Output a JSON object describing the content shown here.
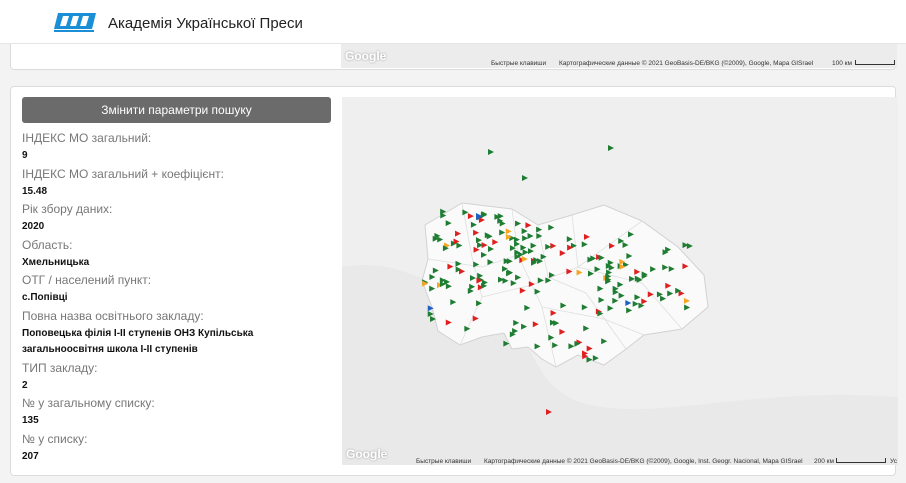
{
  "header": {
    "brand": "Академія Української Преси",
    "logo_icon": "aup-logo-icon"
  },
  "top_map": {
    "google": "Google",
    "shortcuts": "Быстрые клавиши",
    "attribution": "Картографические данные © 2021 GeoBasis-DE/BKG (©2009), Google, Mapa GISrael",
    "scale": "100 км"
  },
  "search": {
    "button_label": "Змінити параметри пошуку"
  },
  "fields": [
    {
      "label": "ІНДЕКС МО загальний:",
      "value": "9"
    },
    {
      "label": "ІНДЕКС МО загальний + коефіцієнт:",
      "value": "15.48"
    },
    {
      "label": "Рік збору даних:",
      "value": "2020"
    },
    {
      "label": "Область:",
      "value": "Хмельницька"
    },
    {
      "label": "ОТГ / населений пункт:",
      "value": "с.Попівці"
    },
    {
      "label": "Повна назва освітнього закладу:",
      "value": "Поповецька філія І-ІІ ступенів ОНЗ Купільська загальноосвітня школа І-ІІ ступенів"
    },
    {
      "label": "ТИП закладу:",
      "value": "2"
    },
    {
      "label": "№ у загальному списку:",
      "value": "135"
    },
    {
      "label": "№ у списку:",
      "value": "207"
    }
  ],
  "map": {
    "google": "Google",
    "shortcuts": "Быстрые клавиши",
    "attribution": "Картографические данные © 2021 GeoBasis-DE/BKG (©2009), Google, Inst. Geogr. Nacional, Mapa GISrael",
    "scale": "200 км",
    "terms": "Ус",
    "marker_colors": {
      "green": "#1e7d32",
      "red": "#e02020",
      "orange": "#f5a623",
      "blue": "#1f5fc4"
    }
  }
}
